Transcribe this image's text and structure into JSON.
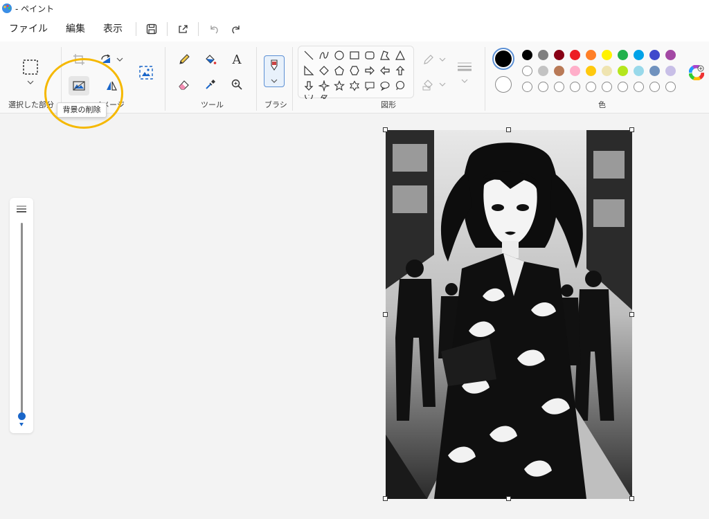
{
  "titlebar": {
    "title": "- ペイント"
  },
  "menubar": {
    "file": "ファイル",
    "edit": "編集",
    "view": "表示"
  },
  "ribbon": {
    "groups": {
      "selection": "選択した部分",
      "image": "イメージ",
      "tools": "ツール",
      "brush": "ブラシ",
      "shapes": "図形",
      "colors": "色"
    },
    "tooltip": "背景の削除",
    "text_tool_glyph": "A"
  },
  "palette": {
    "current_primary": "#000000",
    "current_secondary": "#ffffff",
    "row1": [
      "#000000",
      "#7f7f7f",
      "#880015",
      "#ed1c24",
      "#ff7f27",
      "#fff200",
      "#22b14c",
      "#00a2e8",
      "#3f48cc",
      "#a349a4"
    ],
    "row2": [
      "#ffffff",
      "#c3c3c3",
      "#b97a57",
      "#ffaec9",
      "#ffc90e",
      "#efe4b0",
      "#b5e61d",
      "#99d9ea",
      "#7092be",
      "#c8bfe7"
    ]
  },
  "icons": {
    "app": "paint-palette-icon",
    "save": "save-icon",
    "share": "share-icon",
    "undo": "undo-icon",
    "redo": "redo-icon",
    "selection": "rectangle-select-icon",
    "crop": "crop-icon",
    "rotate": "rotate-icon",
    "remove_background": "remove-background-icon",
    "flip": "flip-icon",
    "image_creator": "image-creator-icon",
    "pencil": "pencil-icon",
    "fill": "fill-bucket-icon",
    "text": "text-icon",
    "eraser": "eraser-icon",
    "color_picker": "color-picker-icon",
    "magnifier": "magnifier-icon",
    "brush": "brush-icon",
    "outline": "outline-icon",
    "fill_style": "fill-style-icon",
    "size": "line-size-icon",
    "edit_colors": "edit-colors-icon"
  }
}
